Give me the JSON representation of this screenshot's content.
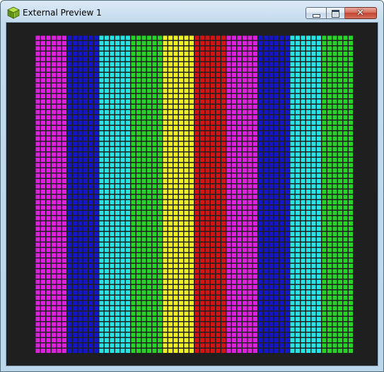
{
  "window": {
    "title": "External Preview 1",
    "close_glyph": "✕"
  },
  "icons": {
    "app": "green-cube-icon",
    "minimize": "minimize-icon",
    "maximize": "maximize-icon",
    "close": "close-icon"
  },
  "preview": {
    "background_color": "#1f1f1f",
    "grid_line_color": "#1f1f1f",
    "bars": [
      {
        "color": "#e020e0"
      },
      {
        "color": "#1414c8"
      },
      {
        "color": "#28e4e4"
      },
      {
        "color": "#28d228"
      },
      {
        "color": "#f0f028"
      },
      {
        "color": "#d21414"
      },
      {
        "color": "#e020e0"
      },
      {
        "color": "#1414c8"
      },
      {
        "color": "#28e4e4"
      },
      {
        "color": "#28d228"
      }
    ]
  }
}
